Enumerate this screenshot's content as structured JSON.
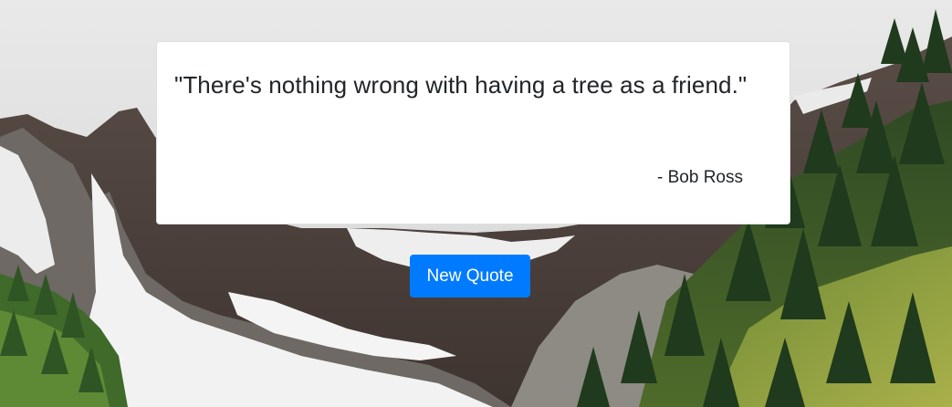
{
  "quote": {
    "text": "\"There's nothing wrong with having a tree as a friend.\"",
    "author": "- Bob Ross"
  },
  "actions": {
    "new_quote_label": "New Quote"
  },
  "colors": {
    "button_primary": "#007bff",
    "card_background": "#ffffff",
    "text": "#212529"
  },
  "background": {
    "scene": "mountain-valley-photo"
  }
}
